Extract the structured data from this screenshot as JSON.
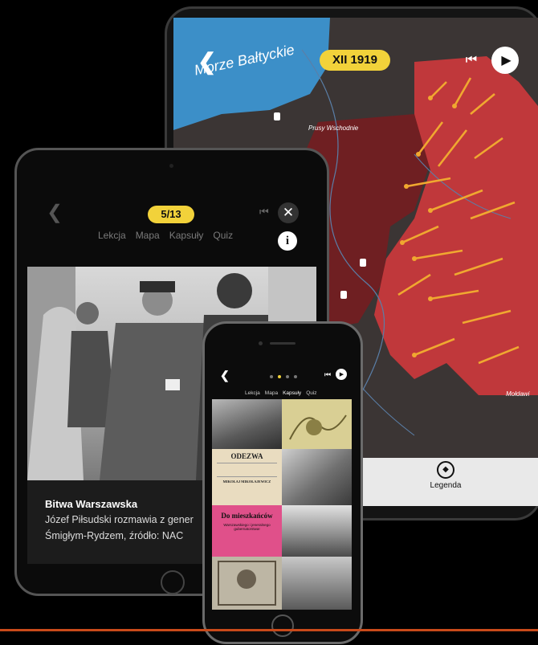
{
  "map": {
    "sea_label": "Morze Bałtyckie",
    "date_pill": "XII 1919",
    "region_label": "Prusy Wschodnie",
    "edge_label": "Mołdawi",
    "legend_label": "Legenda",
    "icons": [
      "back-chevron-icon",
      "skip-back-icon",
      "play-icon",
      "compass-icon"
    ]
  },
  "front_tablet": {
    "page_counter": "5/13",
    "tabs": [
      "Lekcja",
      "Mapa",
      "Kapsuły",
      "Quiz"
    ],
    "caption_title": "Bitwa Warszawska",
    "caption_line1": "Józef Piłsudski rozmawia z gener",
    "caption_line2": "Śmigłym-Rydzem, źródło: NAC",
    "icons": [
      "back-chevron-icon",
      "skip-back-icon",
      "close-icon",
      "info-icon"
    ]
  },
  "phone": {
    "tabs": [
      "Lekcja",
      "Mapa",
      "Kapsuły",
      "Quiz"
    ],
    "gallery": {
      "odezwa_title": "ODEZWA",
      "odezwa_name": "MIKOŁAJ MIKOŁAJEWICZ",
      "mieszkancow_title": "Do mieszkańców",
      "mieszkancow_subtitle": "Warszawskiego i jeneralnego gubernatorstwa!"
    },
    "icons": [
      "back-chevron-icon",
      "skip-back-icon",
      "play-icon"
    ]
  },
  "colors": {
    "accent_yellow": "#f2d23a",
    "map_red": "#c0383b",
    "sea_blue": "#3c8fc8",
    "arrow_orange": "#f0a830"
  }
}
